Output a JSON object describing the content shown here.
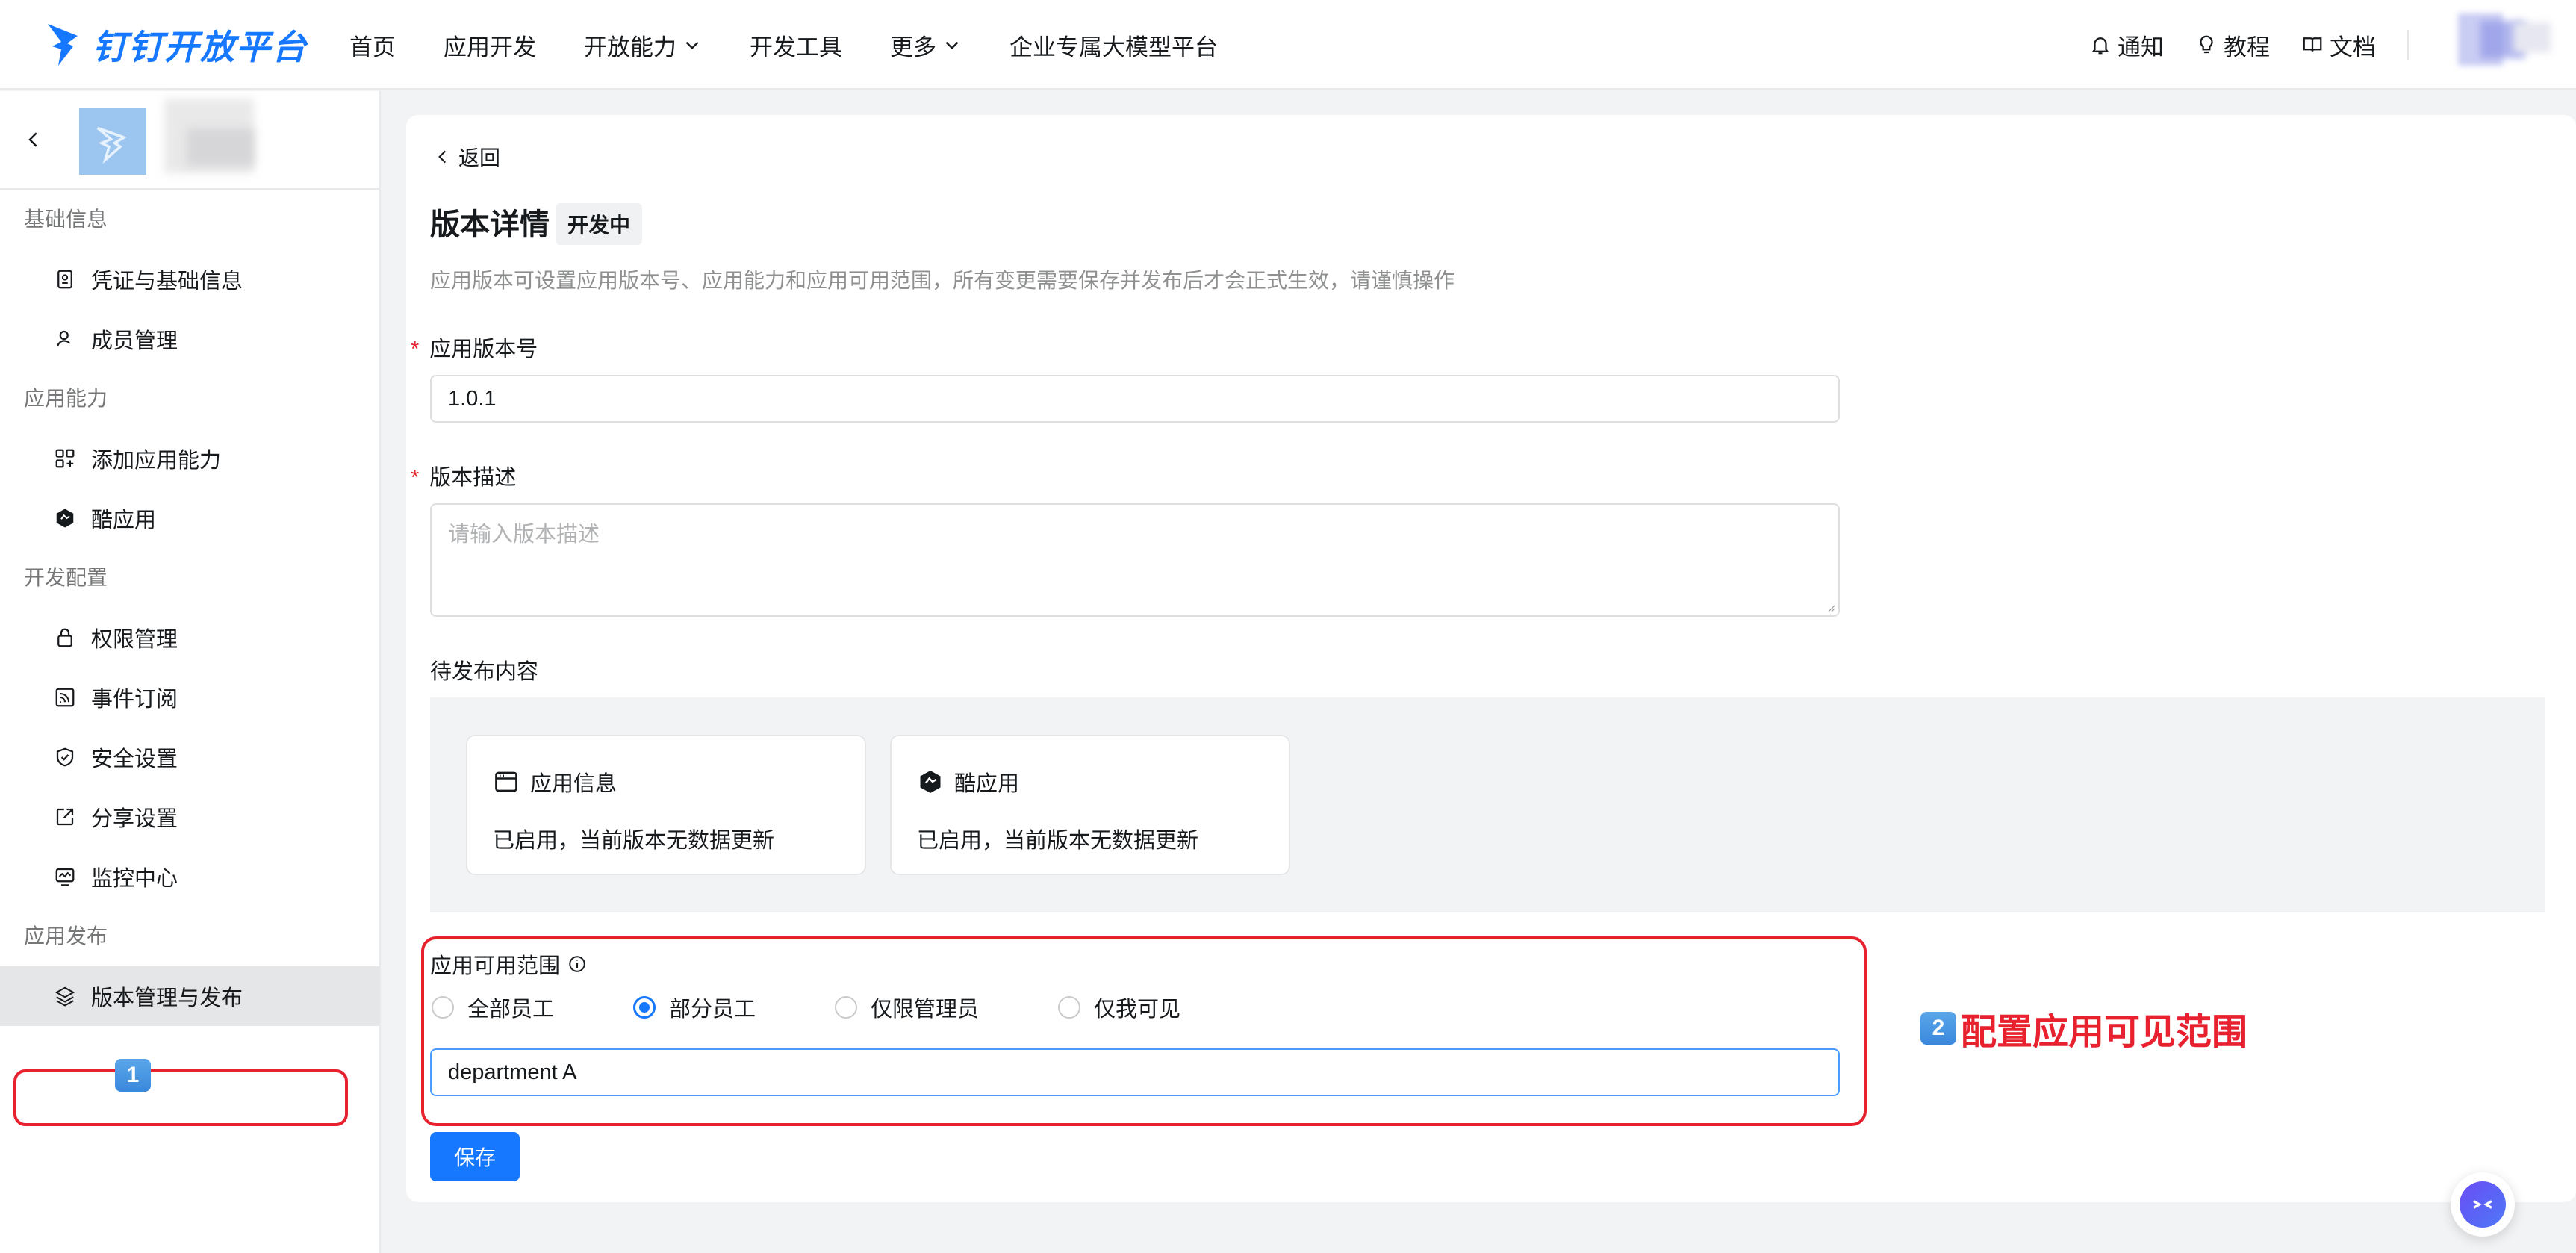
{
  "brand": {
    "name": "钉钉开放平台",
    "color": "#1677ff"
  },
  "topnav": {
    "items": [
      {
        "label": "首页"
      },
      {
        "label": "应用开发"
      },
      {
        "label": "开放能力"
      },
      {
        "label": "开发工具"
      },
      {
        "label": "更多"
      },
      {
        "label": "企业专属大模型平台"
      }
    ],
    "right": {
      "notify": "通知",
      "tutorial": "教程",
      "docs": "文档"
    }
  },
  "sidebar": {
    "groups": [
      {
        "title": "基础信息",
        "items": [
          {
            "label": "凭证与基础信息",
            "icon": "credential-icon"
          },
          {
            "label": "成员管理",
            "icon": "member-icon"
          }
        ]
      },
      {
        "title": "应用能力",
        "items": [
          {
            "label": "添加应用能力",
            "icon": "grid-add-icon"
          },
          {
            "label": "酷应用",
            "icon": "cool-app-icon"
          }
        ]
      },
      {
        "title": "开发配置",
        "items": [
          {
            "label": "权限管理",
            "icon": "lock-icon"
          },
          {
            "label": "事件订阅",
            "icon": "rss-icon"
          },
          {
            "label": "安全设置",
            "icon": "shield-icon"
          },
          {
            "label": "分享设置",
            "icon": "share-icon"
          },
          {
            "label": "监控中心",
            "icon": "monitor-icon"
          }
        ]
      },
      {
        "title": "应用发布",
        "items": [
          {
            "label": "版本管理与发布",
            "icon": "layers-icon",
            "active": true
          }
        ]
      }
    ]
  },
  "main": {
    "back": "返回",
    "title": "版本详情",
    "status": "开发中",
    "description": "应用版本可设置应用版本号、应用能力和应用可用范围，所有变更需要保存并发布后才会正式生效，请谨慎操作",
    "version": {
      "label": "应用版本号",
      "value": "1.0.1"
    },
    "desc_field": {
      "label": "版本描述",
      "placeholder": "请输入版本描述"
    },
    "pending": {
      "title": "待发布内容",
      "cards": [
        {
          "title": "应用信息",
          "body": "已启用，当前版本无数据更新",
          "icon": "window-icon"
        },
        {
          "title": "酷应用",
          "body": "已启用，当前版本无数据更新",
          "icon": "cool-app-icon"
        }
      ]
    },
    "range": {
      "label": "应用可用范围",
      "options": [
        {
          "label": "全部员工",
          "checked": false
        },
        {
          "label": "部分员工",
          "checked": true
        },
        {
          "label": "仅限管理员",
          "checked": false
        },
        {
          "label": "仅我可见",
          "checked": false
        }
      ],
      "selected_value": "department A"
    },
    "save": "保存"
  },
  "annotations": {
    "step1": "1",
    "step2_num": "2",
    "step2_text": "配置应用可见范围",
    "color": "#e8212f"
  }
}
